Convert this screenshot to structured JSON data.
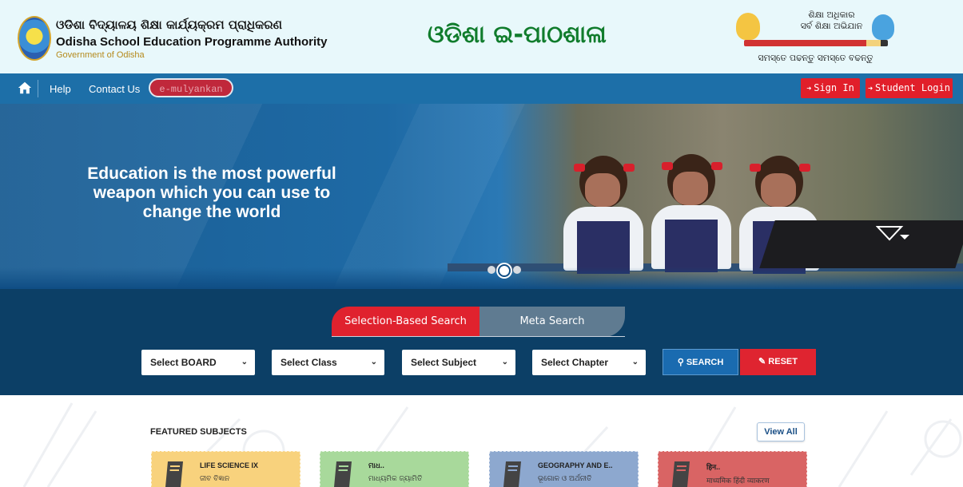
{
  "header": {
    "org_odia": "ଓଡିଶା ବିଦ୍ୟାଳୟ ଶିକ୍ଷା କାର୍ଯ୍ୟକ୍ରମ ପ୍ରାଧିକରଣ",
    "org_english": "Odisha School Education Programme Authority",
    "org_government": "Government of Odisha",
    "site_title": "ଓଡିଶା ଇ-ପାଠଶାଳା",
    "ssa_line1": "ଶିକ୍ଷା ଅଧିକାର",
    "ssa_line2": "ସର୍ବ ଶିକ୍ଷା ଅଭିଯାନ",
    "ssa_line3": "ସମସ୍ତେ ପଢନ୍ତୁ ସମସ୍ତେ ବଢନ୍ତୁ"
  },
  "nav": {
    "help": "Help",
    "contact": "Contact Us",
    "emulyankan": "e-mulyankan",
    "sign_in": "Sign In",
    "student_login": "Student Login"
  },
  "banner": {
    "slogan_line1": "Education is the most powerful",
    "slogan_line2": "weapon which you can use to",
    "slogan_line3": "change the world",
    "slide_count": 3,
    "active_slide": 2
  },
  "search": {
    "tab_selection": "Selection-Based Search",
    "tab_meta": "Meta Search",
    "board_placeholder": "Select BOARD",
    "class_placeholder": "Select Class",
    "subject_placeholder": "Select Subject",
    "chapter_placeholder": "Select Chapter",
    "search_label": "SEARCH",
    "reset_label": "RESET"
  },
  "featured": {
    "title": "FEATURED SUBJECTS",
    "view_all": "View All",
    "cards": [
      {
        "title": "LIFE SCIENCE IX",
        "subtitle": "ଜୀବ ବିଜ୍ଞାନ",
        "color": "#f8d27d"
      },
      {
        "title": "ମାଧ..",
        "subtitle": "ମାଧ୍ୟମିକ ଜ୍ୟାମିତି",
        "color": "#a8d99b"
      },
      {
        "title": "GEOGRAPHY AND E..",
        "subtitle": "ଭୂଗୋଳ ଓ ଅର୍ଥନୀତି",
        "color": "#8da8cf"
      },
      {
        "title": "हिन..",
        "subtitle": "माध्यमिक हिंदी व्याकरण",
        "color": "#d96464"
      }
    ]
  },
  "colors": {
    "nav_blue": "#1d6fa8",
    "search_bg": "#0c3f66",
    "accent_red": "#e11f2a",
    "title_green": "#107c2c"
  }
}
